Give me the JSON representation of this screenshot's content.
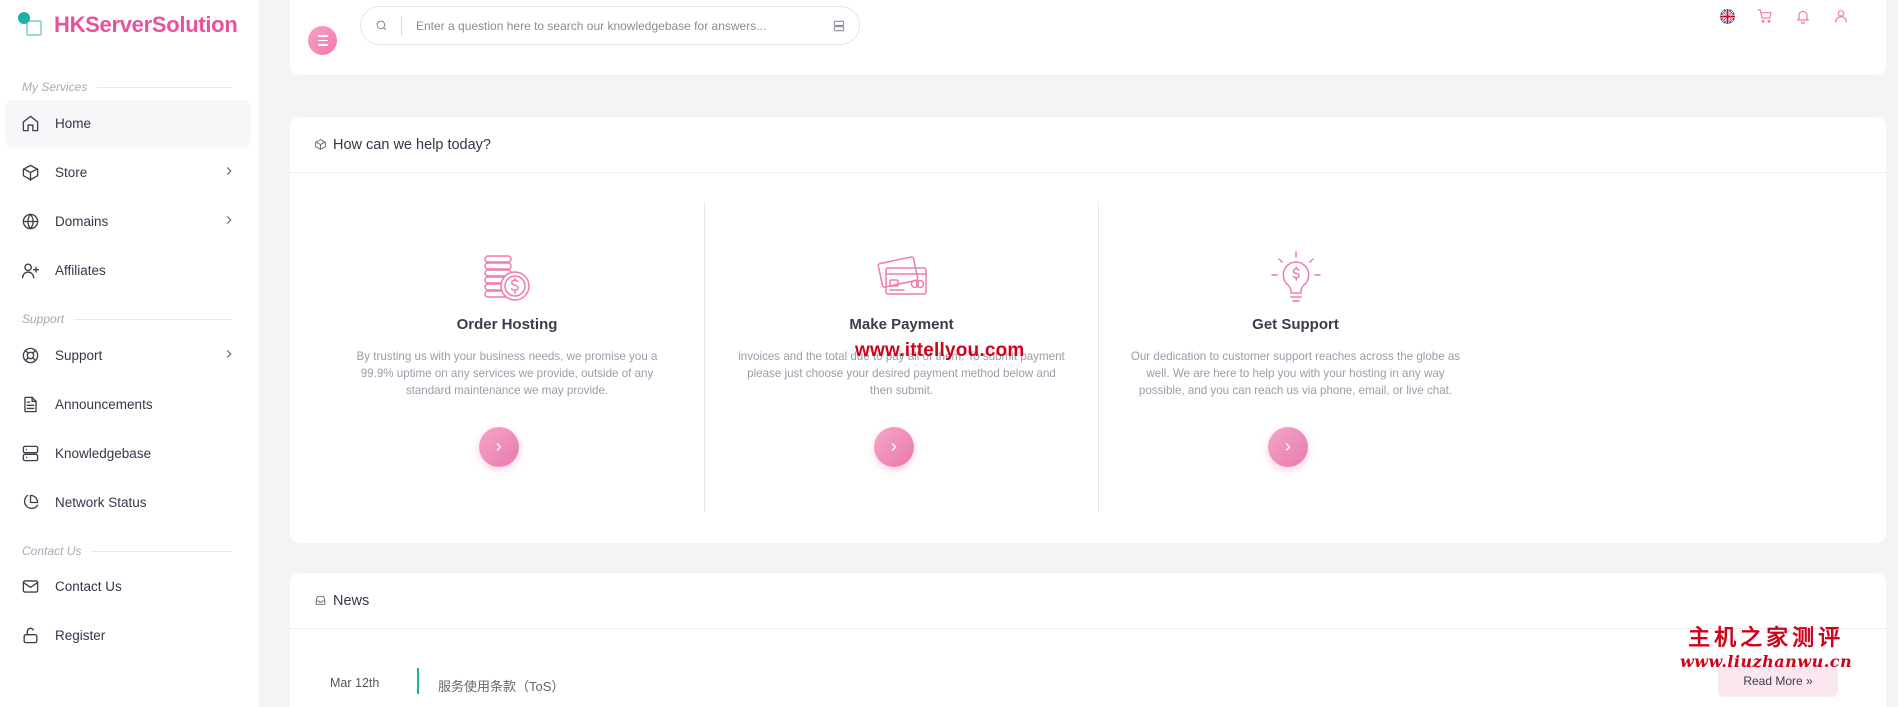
{
  "brand": {
    "name": "HKServerSolution"
  },
  "sidebar": {
    "sections": [
      {
        "title": "My Services"
      },
      {
        "title": "Support"
      },
      {
        "title": "Contact Us"
      }
    ],
    "items": [
      {
        "label": "Home",
        "icon": "home-icon"
      },
      {
        "label": "Store",
        "icon": "box-icon"
      },
      {
        "label": "Domains",
        "icon": "globe-icon"
      },
      {
        "label": "Affiliates",
        "icon": "user-plus-icon"
      },
      {
        "label": "Support",
        "icon": "lifebuoy-icon"
      },
      {
        "label": "Announcements",
        "icon": "document-icon"
      },
      {
        "label": "Knowledgebase",
        "icon": "server-icon"
      },
      {
        "label": "Network Status",
        "icon": "pie-chart-icon"
      },
      {
        "label": "Contact Us",
        "icon": "mail-icon"
      },
      {
        "label": "Register",
        "icon": "lock-icon"
      }
    ]
  },
  "search": {
    "placeholder": "Enter a question here to search our knowledgebase for answers..."
  },
  "help": {
    "title": "How can we help today?",
    "cards": [
      {
        "title": "Order Hosting",
        "text": "By trusting us with your business needs, we promise you a 99.9% uptime on any services we provide, outside of any standard maintenance we may provide."
      },
      {
        "title": "Make Payment",
        "text": "invoices and the total due to pay all of them. To submit payment please just choose your desired payment method below and then submit."
      },
      {
        "title": "Get Support",
        "text": "Our dedication to customer support reaches across the globe as well. We are here to help you with your hosting in any way possible, and you can reach us via phone, email, or live chat."
      }
    ]
  },
  "news": {
    "title": "News",
    "items": [
      {
        "date": "Mar 12th",
        "title": "服务使用条款（ToS）",
        "read_more": "Read More »"
      }
    ]
  },
  "watermarks": {
    "site1": "www.ittellyou.com",
    "site2_cn": "主机之家测评",
    "site2_url": "www.liuzhanwu.cn"
  },
  "colors": {
    "accent": "#f07ab0",
    "brand": "#e8529a",
    "teal": "#19b4a3"
  }
}
